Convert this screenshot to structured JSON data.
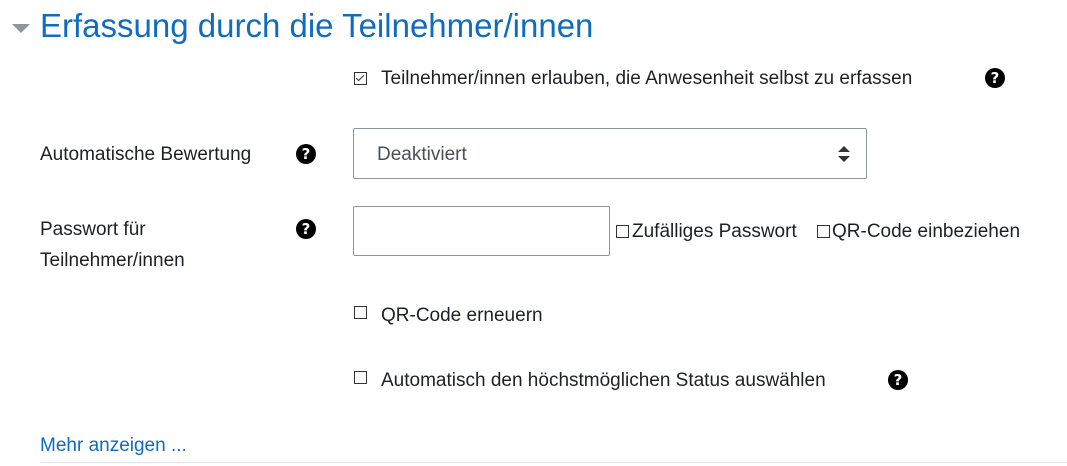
{
  "section": {
    "title": "Erfassung durch die Teilnehmer/innen"
  },
  "options": {
    "allow_self_marking": {
      "label": "Teilnehmer/innen erlauben, die Anwesenheit selbst zu erfassen",
      "checked": true
    },
    "auto_grading": {
      "label": "Automatische Bewertung",
      "value": "Deaktiviert"
    },
    "password": {
      "label_line1": "Passwort für",
      "label_line2": "Teilnehmer/innen",
      "value": "",
      "random_password_label": "Zufälliges Passwort",
      "include_qr_label": "QR-Code einbeziehen"
    },
    "rotate_qr": {
      "label": "QR-Code erneuern",
      "checked": false
    },
    "auto_status": {
      "label": "Automatisch den höchstmöglichen Status auswählen",
      "checked": false
    }
  },
  "more_link": "Mehr anzeigen ..."
}
